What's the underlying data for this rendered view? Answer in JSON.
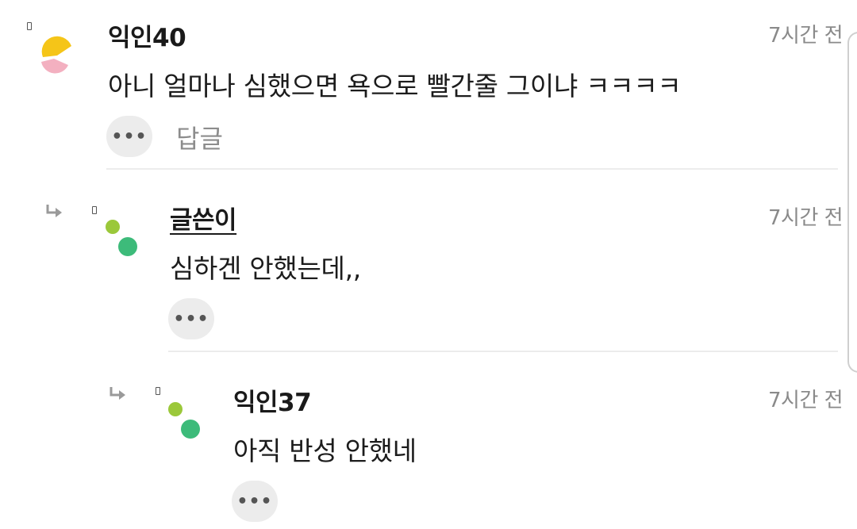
{
  "comments": [
    {
      "author": "익인40",
      "time": "7시간 전",
      "content": "아니 얼마나 심했으면 욕으로 빨간줄 그이냐 ㅋㅋㅋㅋ",
      "more_label": "•••",
      "reply_label": "답글"
    },
    {
      "author": "글쓴이",
      "time": "7시간 전",
      "content": "심하겐 안했는데,,",
      "more_label": "•••"
    },
    {
      "author": "익인37",
      "time": "7시간 전",
      "content": "아직 반성 안했네",
      "more_label": "•••"
    }
  ],
  "colors": {
    "avatar1_yellow": "#f5c518",
    "avatar1_pink": "#f3b0c0",
    "avatar_lime": "#9bc83a",
    "avatar_green": "#3dbb7a"
  }
}
